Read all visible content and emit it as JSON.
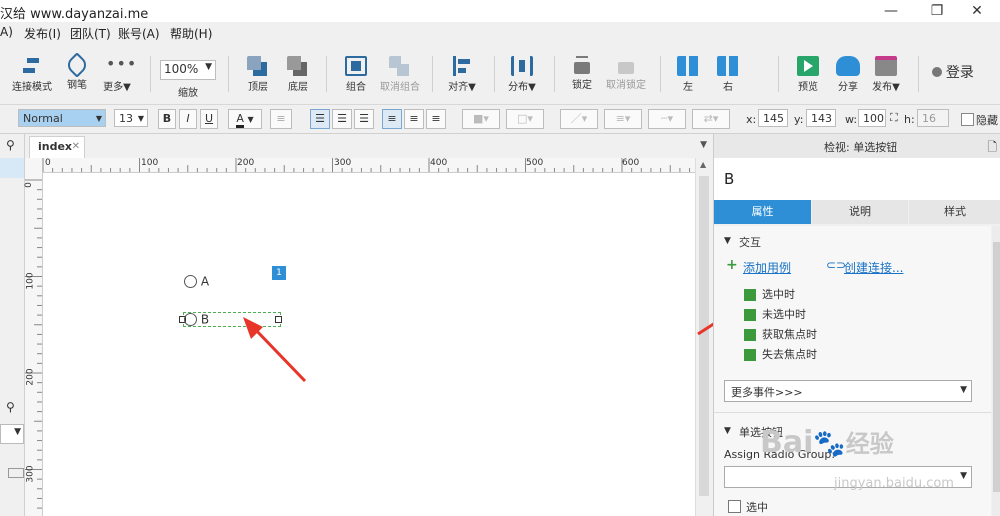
{
  "titlebar": {
    "title": "汉给 www.dayanzai.me",
    "minimize": "—",
    "restore": "❐",
    "close": "✕"
  },
  "menu": [
    "A)",
    "发布(I)",
    "团队(T)",
    "账号(A)",
    "帮助(H)"
  ],
  "toolbar": {
    "connect_mode": "连接模式",
    "pen": "钢笔",
    "more": "更多▼",
    "zoom_value": "100%",
    "zoom_label": "缩放",
    "front": "顶层",
    "back": "底层",
    "group": "组合",
    "ungroup": "取消组合",
    "align": "对齐▼",
    "distribute": "分布▼",
    "lock": "锁定",
    "unlock": "取消锁定",
    "left": "左",
    "right": "右",
    "preview": "预览",
    "share": "分享",
    "publish": "发布▼",
    "login": "登录"
  },
  "format": {
    "style": "Normal",
    "font_size": "13",
    "bold": "B",
    "italic": "I",
    "underline": "U",
    "font_color_glyph": "A",
    "x_label": "x:",
    "x_value": "145",
    "y_label": "y:",
    "y_value": "143",
    "w_label": "w:",
    "w_value": "100",
    "h_label": "h:",
    "h_value": "16",
    "hide_label": "隐藏"
  },
  "canvas": {
    "tab_name": "index",
    "tab_close": "✕",
    "hruler_labels": [
      "0",
      "100",
      "200",
      "300",
      "400",
      "500",
      "600"
    ],
    "vruler_labels": [
      "0",
      "100",
      "200",
      "300"
    ],
    "radio_a": "A",
    "radio_b": "B",
    "badge": "1"
  },
  "inspector": {
    "header": "检视: 单选按钮",
    "widget_name": "B",
    "tabs": [
      "属性",
      "说明",
      "样式"
    ],
    "interaction_section": "交互",
    "add_case": "添加用例",
    "create_link": "创建连接...",
    "events": [
      "选中时",
      "未选中时",
      "获取焦点时",
      "失去焦点时"
    ],
    "more_events": "更多事件>>>",
    "radio_section": "单选按钮",
    "assign_group_label": "Assign Radio Group:",
    "selected_label": "选中"
  },
  "watermark": {
    "brand": "Bai",
    "brand_cn": "经验",
    "url": "jingyan.baidu.com"
  },
  "colors": {
    "accent": "#2e8fd6",
    "arrow": "#e8352a",
    "event_icon": "#3c9a3c"
  }
}
